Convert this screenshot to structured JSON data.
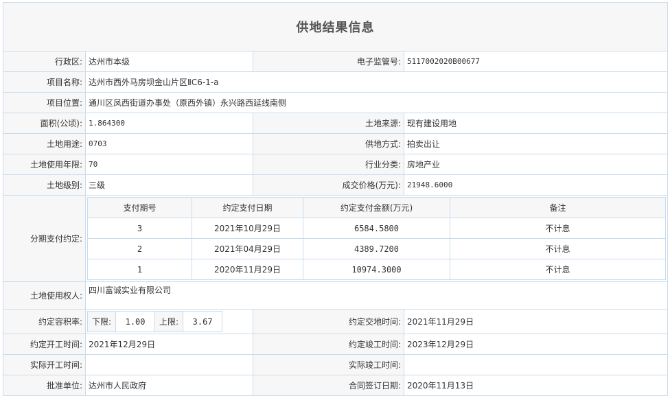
{
  "title": "供地结果信息",
  "fields": {
    "district_label": "行政区:",
    "district_value": "达州市本级",
    "supervision_no_label": "电子监管号:",
    "supervision_no_value": "5117002020B00677",
    "project_name_label": "项目名称:",
    "project_name_value": "达州市西外马房坝金山片区ⅡC6-1-a",
    "project_location_label": "项目位置:",
    "project_location_value": "通川区凤西街道办事处（原西外镇）永兴路西延线南侧",
    "area_label": "面积(公顷):",
    "area_value": "1.864300",
    "land_source_label": "土地来源:",
    "land_source_value": "现有建设用地",
    "land_use_label": "土地用途:",
    "land_use_value": "0703",
    "supply_method_label": "供地方式:",
    "supply_method_value": "拍卖出让",
    "use_years_label": "土地使用年限:",
    "use_years_value": "70",
    "industry_label": "行业分类:",
    "industry_value": "房地产业",
    "land_grade_label": "土地级别:",
    "land_grade_value": "三级",
    "deal_price_label": "成交价格(万元):",
    "deal_price_value": "21948.6000",
    "installment_label": "分期支付约定:",
    "land_user_label": "土地使用权人:",
    "land_user_value": "四川富诚实业有限公司",
    "far_label": "约定容积率:",
    "far_lower_label": "下限:",
    "far_lower_value": "1.00",
    "far_upper_label": "上限:",
    "far_upper_value": "3.67",
    "delivery_time_label": "约定交地时间:",
    "delivery_time_value": "2021年11月29日",
    "start_time_label": "约定开工时间:",
    "start_time_value": "2021年12月29日",
    "completion_time_label": "约定竣工时间:",
    "completion_time_value": "2023年12月29日",
    "actual_start_label": "实际开工时间:",
    "actual_start_value": "",
    "actual_completion_label": "实际竣工时间:",
    "actual_completion_value": "",
    "approval_unit_label": "批准单位:",
    "approval_unit_value": "达州市人民政府",
    "contract_date_label": "合同签订日期:",
    "contract_date_value": "2020年11月13日"
  },
  "payments": {
    "headers": [
      "支付期号",
      "约定支付日期",
      "约定支付金额(万元)",
      "备注"
    ],
    "rows": [
      [
        "3",
        "2021年10月29日",
        "6584.5800",
        "不计息"
      ],
      [
        "2",
        "2021年04月29日",
        "4389.7200",
        "不计息"
      ],
      [
        "1",
        "2020年11月29日",
        "10974.3000",
        "不计息"
      ]
    ]
  },
  "colors": {
    "border": "#c9dcec",
    "label_bg": "#f7f7f7"
  }
}
